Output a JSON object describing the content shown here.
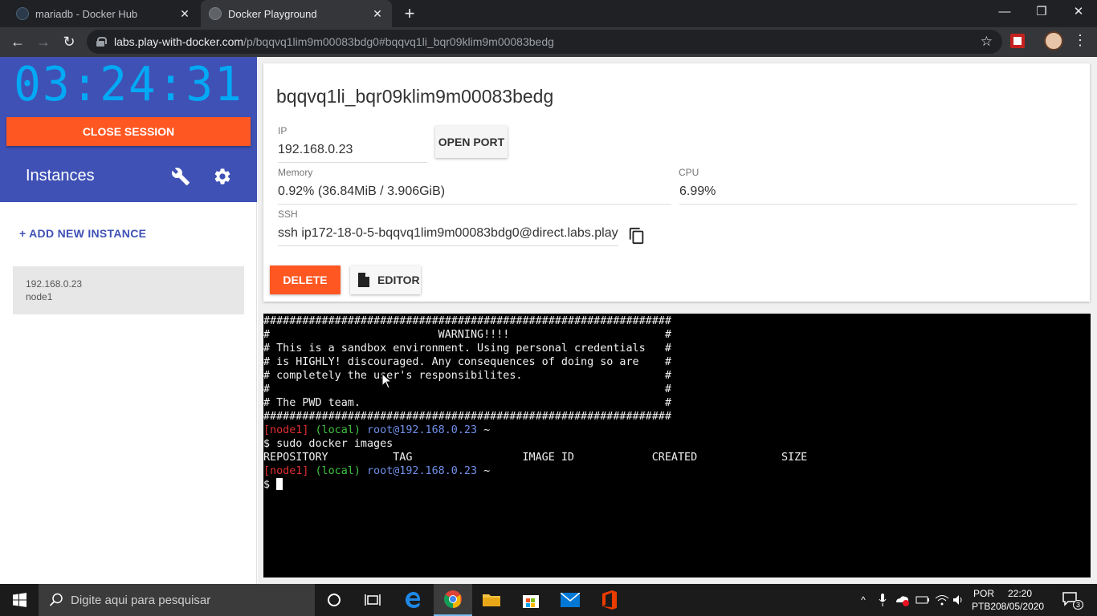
{
  "browser": {
    "tabs": [
      {
        "title": "mariadb - Docker Hub",
        "active": false
      },
      {
        "title": "Docker Playground",
        "active": true
      }
    ],
    "url_host": "labs.play-with-docker.com",
    "url_path": "/p/bqqvq1lim9m00083bdg0#bqqvq1li_bqr09klim9m00083bedg"
  },
  "sidebar": {
    "timer": "03:24:31",
    "close_session": "CLOSE SESSION",
    "instances_title": "Instances",
    "add_instance": "+ ADD NEW INSTANCE",
    "instances": [
      {
        "ip": "192.168.0.23",
        "name": "node1"
      }
    ]
  },
  "instance": {
    "name": "bqqvq1li_bqr09klim9m00083bedg",
    "ip_label": "IP",
    "ip_value": "192.168.0.23",
    "open_port": "OPEN PORT",
    "memory_label": "Memory",
    "memory_value": "0.92% (36.84MiB / 3.906GiB)",
    "cpu_label": "CPU",
    "cpu_value": "6.99%",
    "ssh_label": "SSH",
    "ssh_value": "ssh ip172-18-0-5-bqqvq1lim9m00083bdg0@direct.labs.play",
    "delete": "DELETE",
    "editor": "EDITOR"
  },
  "terminal": {
    "banner": [
      "###############################################################",
      "#                          WARNING!!!!                        #",
      "# This is a sandbox environment. Using personal credentials   #",
      "# is HIGHLY! discouraged. Any consequences of doing so are    #",
      "# completely the user's responsibilites.                      #",
      "#                                                             #",
      "# The PWD team.                                               #",
      "###############################################################"
    ],
    "prompt_node": "[node1]",
    "prompt_local": "(local)",
    "prompt_host": "root@192.168.0.23",
    "prompt_tilde": " ~",
    "command": "$ sudo docker images",
    "header": "REPOSITORY          TAG                 IMAGE ID            CREATED             SIZE",
    "dollar": "$ "
  },
  "taskbar": {
    "search_placeholder": "Digite aqui para pesquisar",
    "lang_line1": "POR",
    "lang_line2": "PTB2",
    "time": "22:20",
    "date": "08/05/2020",
    "notification_count": "3"
  }
}
